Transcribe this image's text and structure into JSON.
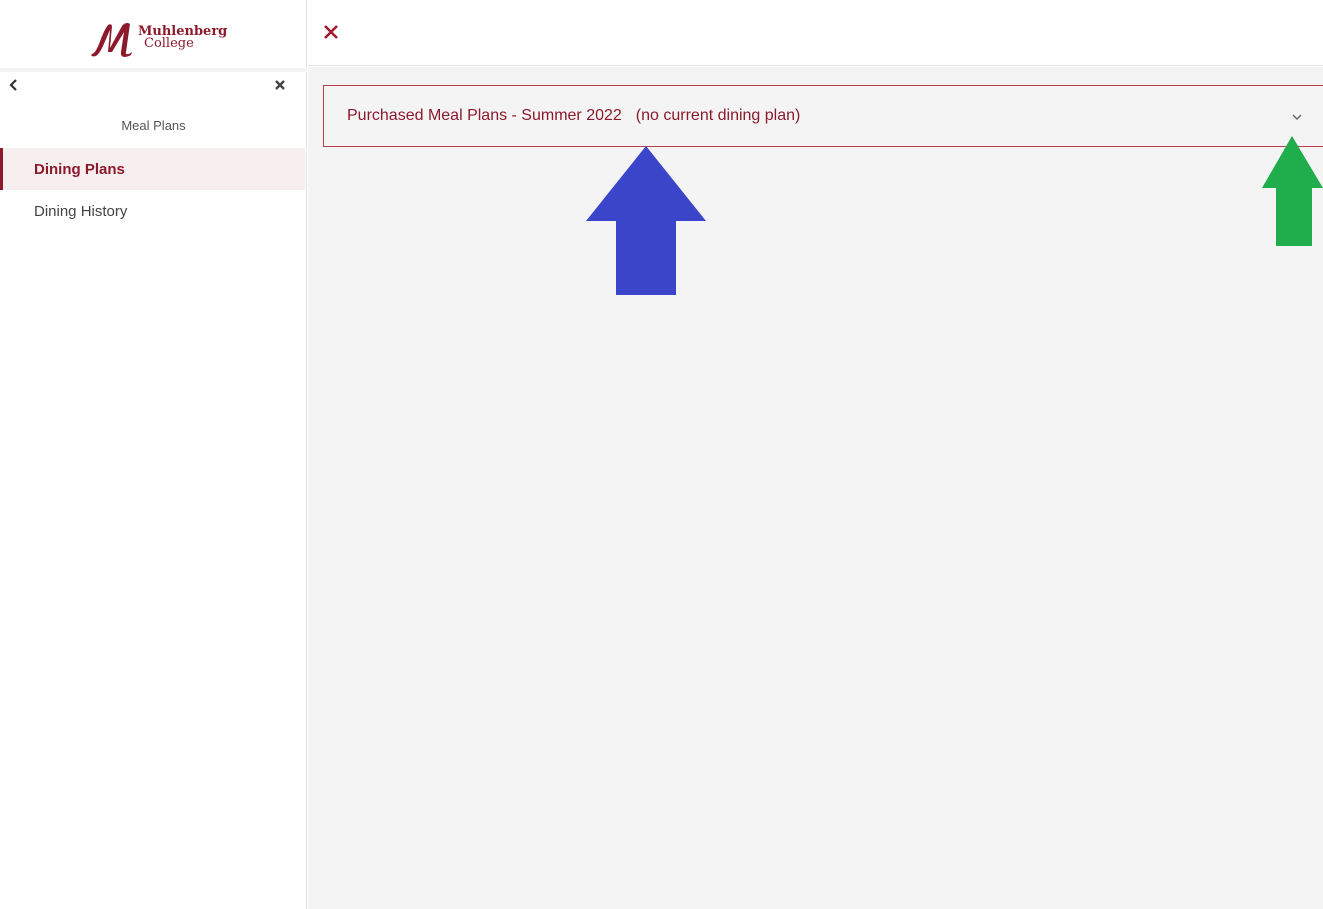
{
  "brand": {
    "name_line1": "Muhlenberg",
    "name_line2": "College",
    "color": "#8b1a2b"
  },
  "sidebar": {
    "back_icon": "chevron-left-icon",
    "close_icon": "close-icon",
    "section_title": "Meal Plans",
    "items": [
      {
        "label": "Dining Plans",
        "active": true
      },
      {
        "label": "Dining History",
        "active": false
      }
    ]
  },
  "topbar": {
    "close_icon": "close-icon",
    "close_glyph": "✕"
  },
  "main": {
    "accordion": {
      "title": "Purchased Meal Plans - Summer 2022",
      "subtitle": "(no current dining plan)",
      "expand_icon": "chevron-down-icon"
    }
  },
  "annotations": {
    "blue_arrow_color": "#3b45c9",
    "green_arrow_color": "#1fae4b"
  }
}
